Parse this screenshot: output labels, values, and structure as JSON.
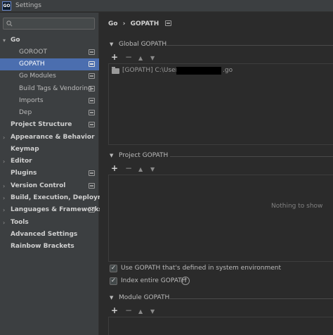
{
  "window": {
    "title": "Settings",
    "app_icon_text": "GO"
  },
  "search": {
    "placeholder": "",
    "icon": "search-icon"
  },
  "sidebar": {
    "items": [
      {
        "label": "Go",
        "level": 0,
        "bold": true,
        "arrow": "down",
        "project_icon": false
      },
      {
        "label": "GOROOT",
        "level": 1,
        "bold": false,
        "project_icon": true
      },
      {
        "label": "GOPATH",
        "level": 1,
        "bold": false,
        "project_icon": true,
        "selected": true
      },
      {
        "label": "Go Modules",
        "level": 1,
        "bold": false,
        "project_icon": true
      },
      {
        "label": "Build Tags & Vendoring",
        "level": 1,
        "bold": false,
        "project_icon": true
      },
      {
        "label": "Imports",
        "level": 1,
        "bold": false,
        "project_icon": true
      },
      {
        "label": "Dep",
        "level": 1,
        "bold": false,
        "project_icon": true
      },
      {
        "label": "Project Structure",
        "level": 0,
        "bold": true,
        "project_icon": true
      },
      {
        "label": "Appearance & Behavior",
        "level": 0,
        "bold": true,
        "arrow": "right",
        "project_icon": false
      },
      {
        "label": "Keymap",
        "level": 0,
        "bold": true,
        "project_icon": false
      },
      {
        "label": "Editor",
        "level": 0,
        "bold": true,
        "arrow": "right",
        "project_icon": false
      },
      {
        "label": "Plugins",
        "level": 0,
        "bold": true,
        "project_icon": true
      },
      {
        "label": "Version Control",
        "level": 0,
        "bold": true,
        "arrow": "right",
        "project_icon": true
      },
      {
        "label": "Build, Execution, Deployment",
        "level": 0,
        "bold": true,
        "arrow": "right",
        "project_icon": false
      },
      {
        "label": "Languages & Frameworks",
        "level": 0,
        "bold": true,
        "arrow": "right",
        "project_icon": true
      },
      {
        "label": "Tools",
        "level": 0,
        "bold": true,
        "arrow": "right",
        "project_icon": false
      },
      {
        "label": "Advanced Settings",
        "level": 0,
        "bold": true,
        "project_icon": false
      },
      {
        "label": "Rainbow Brackets",
        "level": 0,
        "bold": true,
        "project_icon": false
      }
    ]
  },
  "breadcrumb": {
    "parent": "Go",
    "separator": "›",
    "current": "GOPATH"
  },
  "global_gopath": {
    "title": "Global GOPATH",
    "toolbar": {
      "add": "+",
      "remove": "−",
      "up": "▲",
      "down": "▼"
    },
    "entry": {
      "prefix": "[GOPATH] C:\\Users\\",
      "suffix": ".go"
    }
  },
  "project_gopath": {
    "title": "Project GOPATH",
    "toolbar": {
      "add": "+",
      "remove": "−",
      "up": "▲",
      "down": "▼"
    },
    "empty_text": "Nothing to show"
  },
  "options": {
    "use_system_gopath": {
      "label": "Use GOPATH that's defined in system environment",
      "checked": true
    },
    "index_entire_gopath": {
      "label": "Index entire GOPATH",
      "checked": true,
      "help": "?"
    }
  },
  "module_gopath": {
    "title": "Module GOPATH",
    "toolbar": {
      "add": "+",
      "remove": "−",
      "up": "▲",
      "down": "▼"
    }
  },
  "colors": {
    "selection": "#4b6eaf",
    "sidebar_bg": "#3c3f41",
    "content_bg": "#2b2b2b"
  }
}
